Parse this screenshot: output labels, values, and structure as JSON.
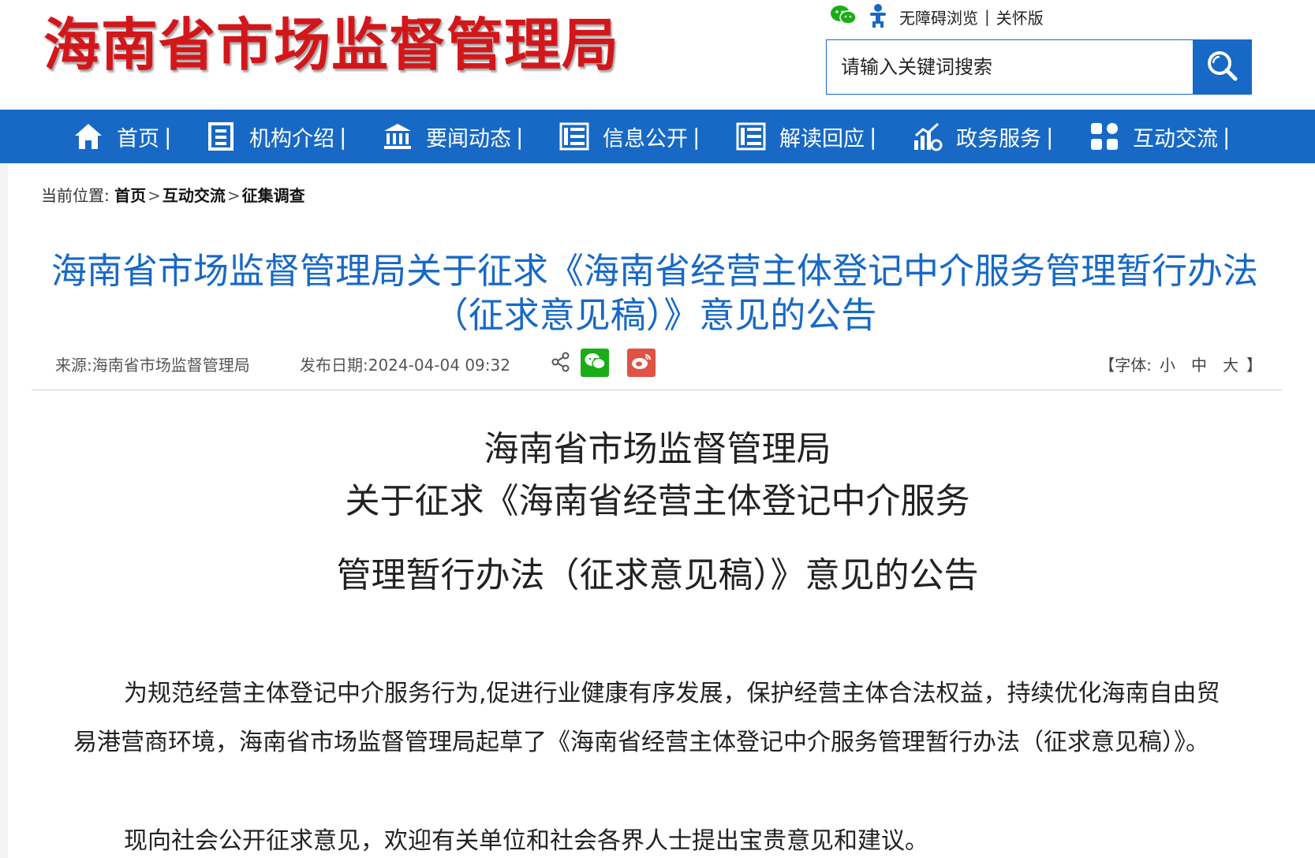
{
  "header": {
    "logo_text": "海南省市场监督管理局",
    "accessibility_label": "无障碍浏览",
    "care_mode_label": "关怀版",
    "search_placeholder": "请输入关键词搜索"
  },
  "nav": {
    "items": [
      {
        "label": "首页",
        "icon": "home-icon"
      },
      {
        "label": "机构介绍",
        "icon": "building-icon"
      },
      {
        "label": "要闻动态",
        "icon": "bank-icon"
      },
      {
        "label": "信息公开",
        "icon": "list-icon"
      },
      {
        "label": "解读回应",
        "icon": "list-icon"
      },
      {
        "label": "政务服务",
        "icon": "chart-icon"
      },
      {
        "label": "互动交流",
        "icon": "grid-icon"
      }
    ],
    "separator": "|"
  },
  "breadcrumb": {
    "prefix": "当前位置:",
    "items": [
      "首页",
      "互动交流",
      "征集调查"
    ],
    "separator": ">"
  },
  "article": {
    "title": "海南省市场监督管理局关于征求《海南省经营主体登记中介服务管理暂行办法（征求意见稿）》意见的公告",
    "source": "来源:海南省市场监督管理局",
    "date": "发布日期:2024-04-04 09:32",
    "font_size_label_open": "【字体:",
    "font_size_small": "小",
    "font_size_medium": "中",
    "font_size_large": "大",
    "font_size_label_close": "】",
    "heading_lines": [
      "海南省市场监督管理局",
      "关于征求《海南省经营主体登记中介服务",
      "管理暂行办法（征求意见稿）》意见的公告"
    ],
    "paragraphs": [
      "为规范经营主体登记中介服务行为,促进行业健康有序发展，保护经营主体合法权益，持续优化海南自由贸易港营商环境，海南省市场监督管理局起草了《海南省经营主体登记中介服务管理暂行办法（征求意见稿）》。",
      "现向社会公开征求意见，欢迎有关单位和社会各界人士提出宝贵意见和建议。"
    ]
  },
  "colors": {
    "brand_blue": "#1769c5",
    "logo_red": "#d2171b",
    "wechat_green": "#1aad19",
    "weibo_red": "#e05244"
  }
}
